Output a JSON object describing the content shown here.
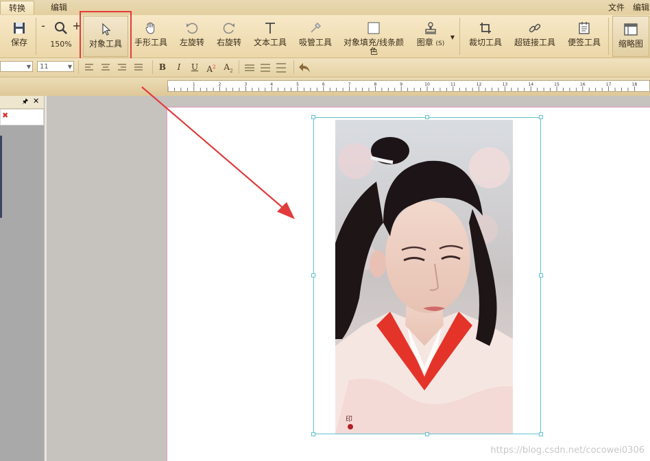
{
  "tabs": {
    "active": "转换",
    "inactive": "编辑"
  },
  "menu_right": {
    "file": "文件",
    "edit": "编辑"
  },
  "ribbon": {
    "save": "保存",
    "zoom_value": "150%",
    "zoom_out_label": "-",
    "zoom_in_label": "+",
    "object_tool": "对象工具",
    "hand_tool": "手形工具",
    "rotate_left": "左旋转",
    "rotate_right": "右旋转",
    "text_tool": "文本工具",
    "eyedropper": "吸管工具",
    "fill_line_color_1": "对象填充/线条颜",
    "fill_line_color_2": "色",
    "stamp": "图章",
    "stamp_shortcut": "(S)",
    "crop": "裁切工具",
    "hyperlink": "超链接工具",
    "sticky_note": "便签工具",
    "thumbnail": "缩略图"
  },
  "format": {
    "font_size": "11",
    "bold": "B",
    "italic": "I",
    "underline": "U",
    "superscript": "A",
    "superscript_mark": "2",
    "subscript": "A",
    "subscript_mark": "2"
  },
  "ruler": {
    "numbers": [
      "1",
      "2",
      "3",
      "4",
      "5",
      "6",
      "7",
      "8",
      "9",
      "10",
      "11",
      "12",
      "13",
      "14",
      "15",
      "16",
      "17",
      "18"
    ]
  },
  "panel": {
    "pin": "🖈",
    "close": "✕",
    "remove": "✖"
  },
  "watermark": "https://blog.csdn.net/cocowei0306",
  "colors": {
    "highlight": "#e23b3b",
    "arrow": "#e23b3b",
    "selection": "#5fc2d0",
    "page_border": "#e59bc6"
  }
}
